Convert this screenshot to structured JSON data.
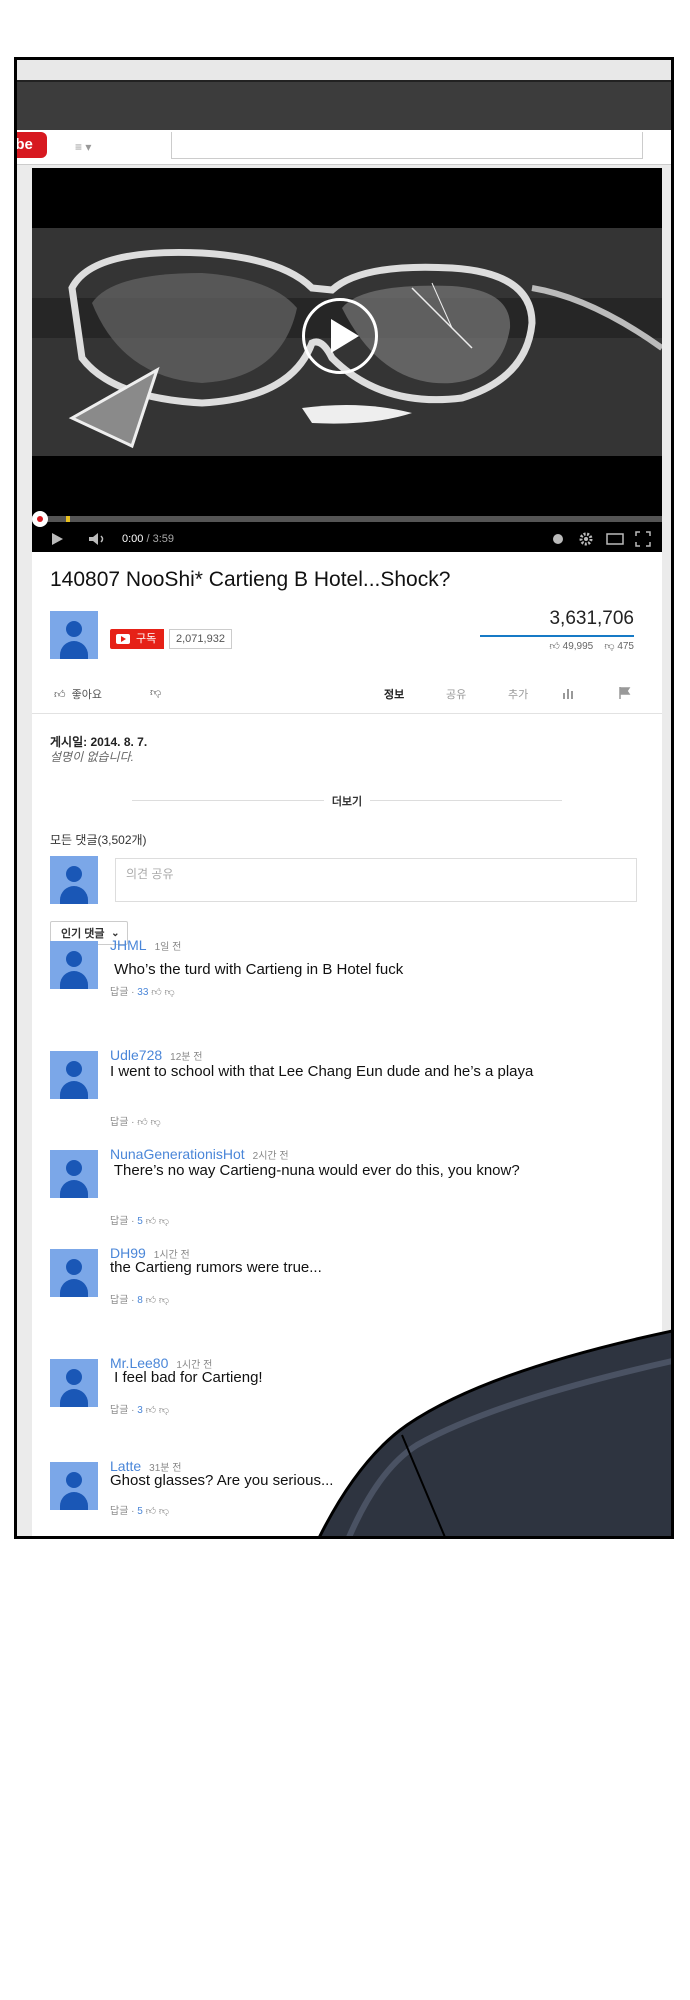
{
  "header": {
    "logo_text": "uTube",
    "guide_label": "≡ ▾"
  },
  "player": {
    "time_current": "0:00",
    "time_sep": " / ",
    "time_duration": "3:59"
  },
  "video": {
    "title": "140807 NooShi* Cartieng B Hotel...Shock?",
    "subscribe_label": "구독",
    "subscriber_count": "2,071,932",
    "views": "3,631,706",
    "likes": "49,995",
    "dislikes": "475"
  },
  "actions": {
    "like_label": "좋아요",
    "info": "정보",
    "share": "공유",
    "add": "추가"
  },
  "description": {
    "published": "게시일: 2014. 8. 7.",
    "text": "설명이 없습니다.",
    "more": "더보기"
  },
  "comments_section": {
    "header": "모든 댓글(3,502개)",
    "input_placeholder": "의견 공유",
    "sort_label": "인기 댓글",
    "reply_label": "답글"
  },
  "comments": [
    {
      "author": "JHML",
      "time": "1일 전",
      "text": " Who’s the turd with Cartieng in B Hotel fuck",
      "likes": "33"
    },
    {
      "author": "Udle728",
      "time": "12분 전",
      "text": "I went to school with that Lee Chang Eun dude and he’s a playa",
      "likes": ""
    },
    {
      "author": "NunaGenerationisHot",
      "time": "2시간 전",
      "text": " There’s no way Cartieng-nuna would ever do this, you know?",
      "likes": "5"
    },
    {
      "author": "DH99",
      "time": "1시간 전",
      "text": "the Cartieng rumors were true...",
      "likes": "8"
    },
    {
      "author": "Mr.Lee80",
      "time": "1시간 전",
      "text": " I feel bad for Cartieng!",
      "likes": "3"
    },
    {
      "author": "Latte",
      "time": "31분 전",
      "text": "Ghost glasses? Are you serious...",
      "likes": "5"
    }
  ],
  "colors": {
    "accent": "#e62117",
    "link": "#4a86d8",
    "avatar": "#7ba7e8"
  }
}
